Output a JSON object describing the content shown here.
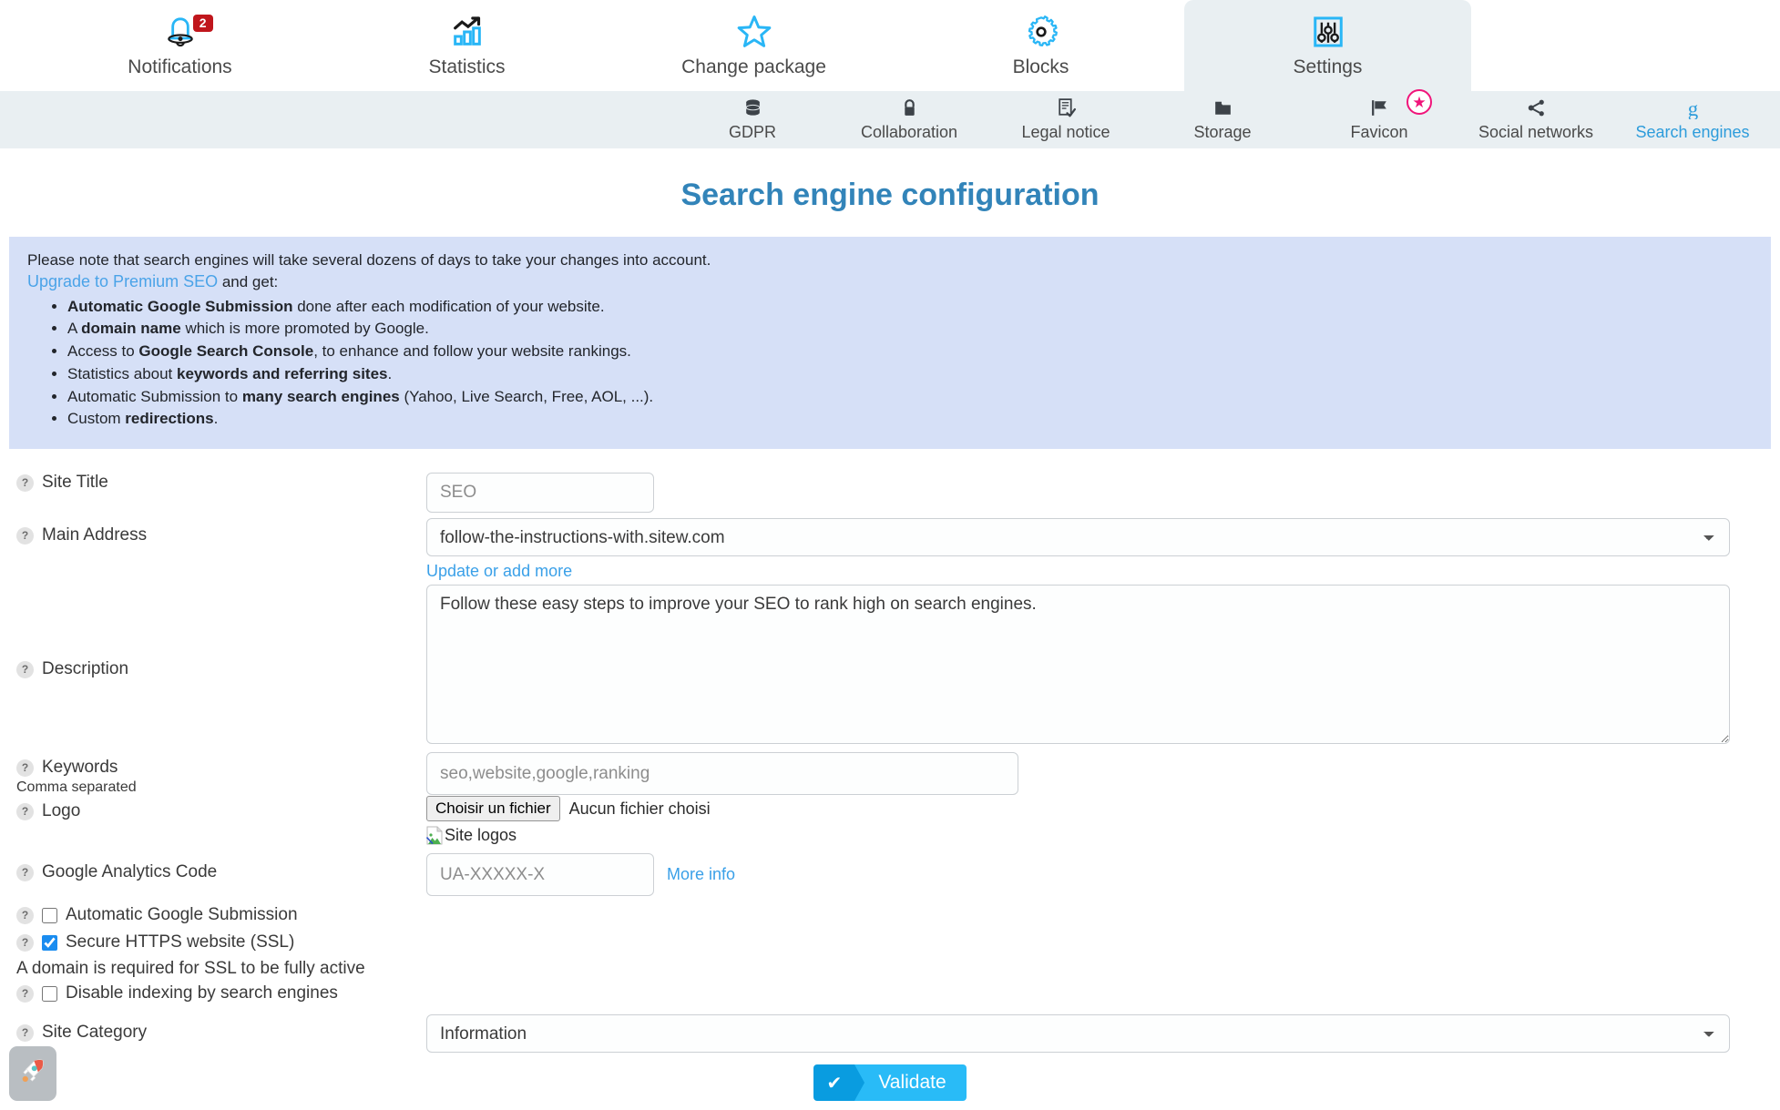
{
  "topnav": [
    {
      "label": "Notifications",
      "icon": "bell-icon",
      "badge": "2",
      "active": false
    },
    {
      "label": "Statistics",
      "icon": "bar-chart-icon",
      "badge": null,
      "active": false
    },
    {
      "label": "Change package",
      "icon": "star-icon",
      "badge": null,
      "active": false
    },
    {
      "label": "Blocks",
      "icon": "gear-icon",
      "badge": null,
      "active": false
    },
    {
      "label": "Settings",
      "icon": "sliders-icon",
      "badge": null,
      "active": true
    }
  ],
  "subnav": [
    {
      "label": "GDPR",
      "icon": "database-icon",
      "active": false,
      "star": false
    },
    {
      "label": "Collaboration",
      "icon": "lock-icon",
      "active": false,
      "star": false
    },
    {
      "label": "Legal notice",
      "icon": "document-check-icon",
      "active": false,
      "star": false
    },
    {
      "label": "Storage",
      "icon": "folder-icon",
      "active": false,
      "star": false
    },
    {
      "label": "Favicon",
      "icon": "flag-icon",
      "active": false,
      "star": true
    },
    {
      "label": "Social networks",
      "icon": "share-icon",
      "active": false,
      "star": false
    },
    {
      "label": "Search engines",
      "icon": "google-g-icon",
      "active": true,
      "star": false
    }
  ],
  "page": {
    "title": "Search engine configuration"
  },
  "banner": {
    "note": "Please note that search engines will take several dozens of days to take your changes into account.",
    "upgrade_link": "Upgrade to Premium SEO",
    "upgrade_suffix": " and get:",
    "bullets": [
      {
        "bold": "Automatic Google Submission",
        "rest": " done after each modification of your website.",
        "prefix": ""
      },
      {
        "bold": "domain name",
        "rest": " which is more promoted by Google.",
        "prefix": "A "
      },
      {
        "bold": "Google Search Console",
        "rest": ", to enhance and follow your website rankings.",
        "prefix": "Access to "
      },
      {
        "bold": "keywords and referring sites",
        "rest": ".",
        "prefix": "Statistics about "
      },
      {
        "bold": "many search engines",
        "rest": " (Yahoo, Live Search, Free, AOL, ...).",
        "prefix": "Automatic Submission to "
      },
      {
        "bold": "redirections",
        "rest": ".",
        "prefix": "Custom "
      }
    ]
  },
  "form": {
    "site_title": {
      "label": "Site Title",
      "placeholder": "SEO",
      "value": ""
    },
    "main_address": {
      "label": "Main Address",
      "selected": "follow-the-instructions-with.sitew.com",
      "options": [
        "follow-the-instructions-with.sitew.com"
      ],
      "link": "Update or add more"
    },
    "description": {
      "label": "Description",
      "value": "Follow these easy steps to improve your SEO to rank high on search engines."
    },
    "keywords": {
      "label": "Keywords",
      "note": "Comma separated",
      "placeholder": "seo,website,google,ranking",
      "value": ""
    },
    "logo": {
      "label": "Logo",
      "button": "Choisir un fichier",
      "file_status": "Aucun fichier choisi",
      "alt_text": "Site logos"
    },
    "google_analytics": {
      "label": "Google Analytics Code",
      "placeholder": "UA-XXXXX-X",
      "value": "",
      "more_info": "More info"
    },
    "auto_google_submission": {
      "label": "Automatic Google Submission",
      "checked": false
    },
    "secure_https": {
      "label": "Secure HTTPS website (SSL)",
      "checked": true
    },
    "ssl_note": "A domain is required for SSL to be fully active",
    "disable_indexing": {
      "label": "Disable indexing by search engines",
      "checked": false
    },
    "site_category": {
      "label": "Site Category",
      "selected": "Information",
      "options": [
        "Information"
      ]
    },
    "validate": {
      "label": "Validate",
      "icon": "check-icon"
    }
  },
  "widget": {
    "icon": "rocket-icon"
  },
  "colors": {
    "accent_blue": "#2d9cdb",
    "title_blue": "#3284b9",
    "banner_bg": "#d6e0f7",
    "subnav_bg": "#e9eff2",
    "badge_red": "#c0161c",
    "star_pink": "#f0147a",
    "validate_light": "#29bbf7",
    "validate_dark": "#099ce0"
  }
}
